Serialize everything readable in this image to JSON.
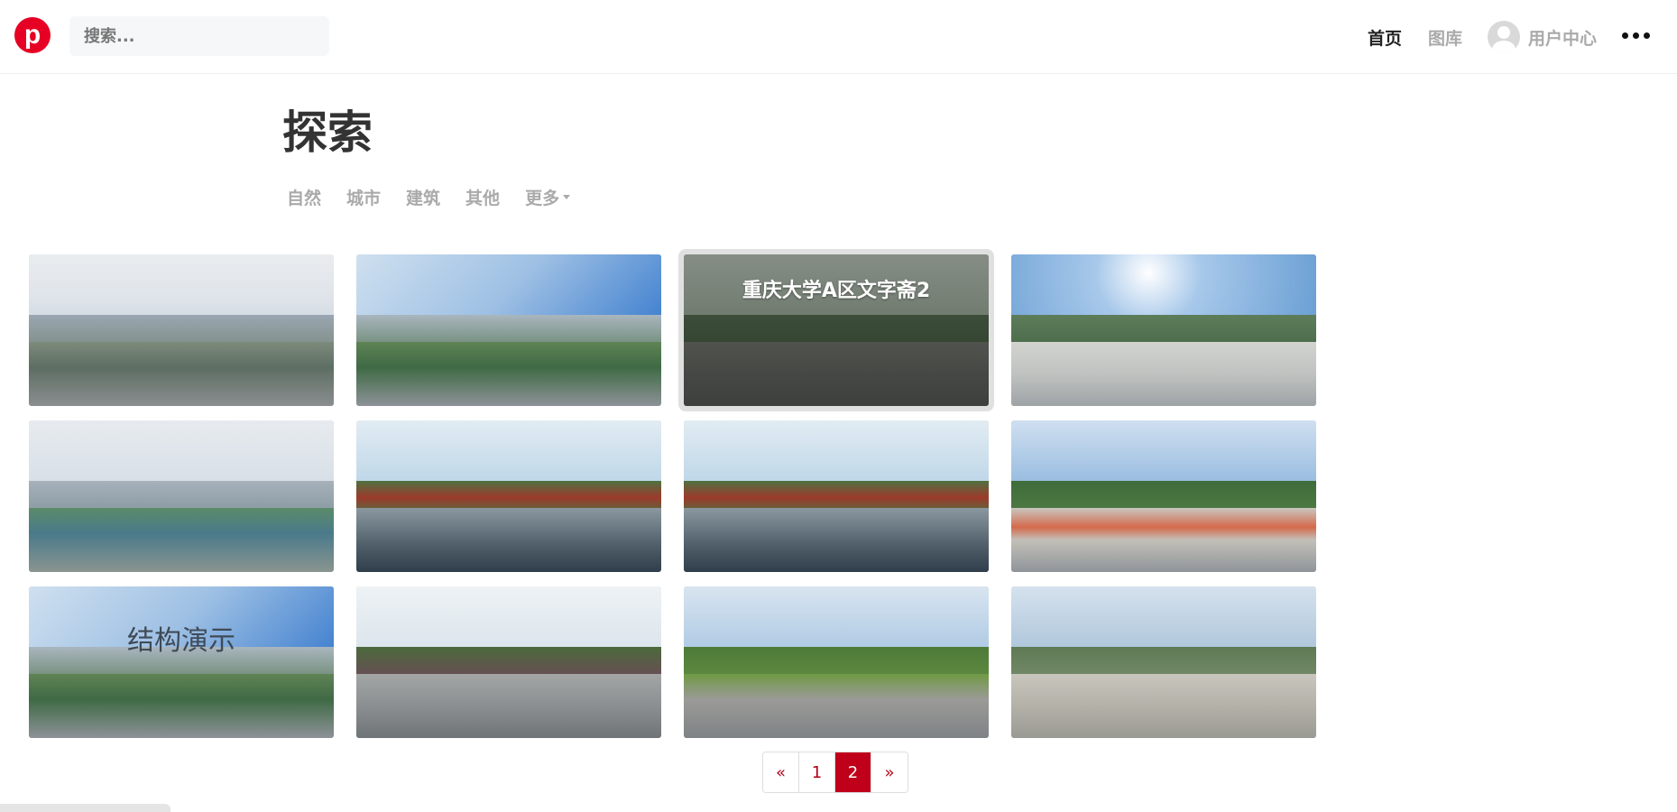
{
  "header": {
    "logo_letter": "p",
    "search_placeholder": "搜索...",
    "nav": {
      "home": "首页",
      "gallery": "图库",
      "user_center": "用户中心"
    }
  },
  "page": {
    "title": "探索",
    "filters": [
      "自然",
      "城市",
      "建筑",
      "其他"
    ],
    "more_label": "更多"
  },
  "gallery": {
    "items": [
      {
        "title": "",
        "watermark": "",
        "scene": "city-cloudy"
      },
      {
        "title": "",
        "watermark": "",
        "scene": "city-blue"
      },
      {
        "title": "重庆大学A区文字斋2",
        "watermark": "",
        "scene": "garden-hover",
        "hovered": true
      },
      {
        "title": "",
        "watermark": "",
        "scene": "plaza-sun"
      },
      {
        "title": "",
        "watermark": "",
        "scene": "city-field"
      },
      {
        "title": "",
        "watermark": "",
        "scene": "campus-building"
      },
      {
        "title": "",
        "watermark": "",
        "scene": "campus-building"
      },
      {
        "title": "",
        "watermark": "",
        "scene": "plaza-red"
      },
      {
        "title": "",
        "watermark": "结构演示",
        "scene": "city-blue"
      },
      {
        "title": "",
        "watermark": "",
        "scene": "garden-path"
      },
      {
        "title": "",
        "watermark": "",
        "scene": "park-path"
      },
      {
        "title": "",
        "watermark": "",
        "scene": "plaza-grey"
      }
    ]
  },
  "pagination": {
    "prev": "«",
    "pages": [
      "1",
      "2"
    ],
    "current": "2",
    "next": "»"
  },
  "colors": {
    "brand": "#e60023",
    "active_page": "#c0001b"
  }
}
